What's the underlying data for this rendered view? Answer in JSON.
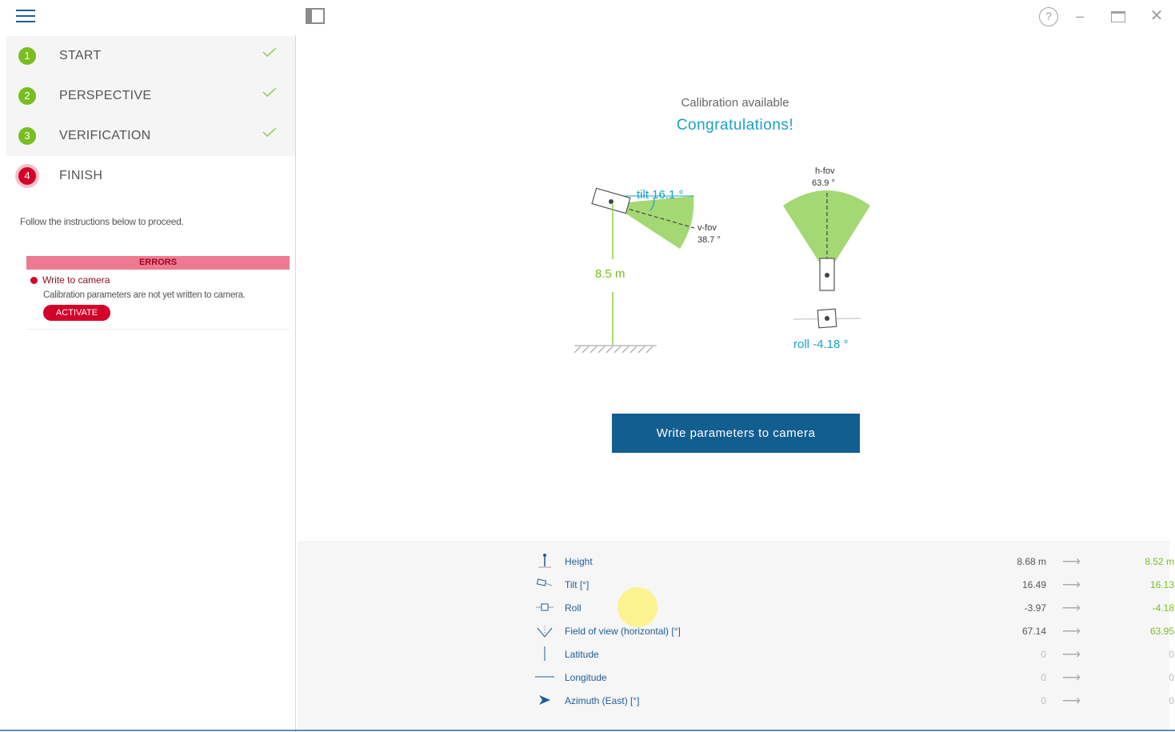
{
  "titlebar": {
    "help_glyph": "?",
    "minimize_glyph": "–",
    "close_glyph": "✕"
  },
  "steps": [
    {
      "number": "1",
      "label": "START",
      "done": true
    },
    {
      "number": "2",
      "label": "PERSPECTIVE",
      "done": true
    },
    {
      "number": "3",
      "label": "VERIFICATION",
      "done": true
    },
    {
      "number": "4",
      "label": "FINISH",
      "done": false
    }
  ],
  "instructions": "Follow the instructions below to proceed.",
  "errors": {
    "header": "ERRORS",
    "items": [
      {
        "title": "Write to camera",
        "description": "Calibration parameters are not yet written to camera.",
        "action_label": "ACTIVATE"
      }
    ]
  },
  "main": {
    "status": "Calibration available",
    "headline": "Congratulations!",
    "write_button_label": "Write parameters to camera"
  },
  "diagram": {
    "tilt_label": "tilt 16.1 °",
    "vfov_label": "v-fov",
    "vfov_value": "38.7 °",
    "height_label": "8.5 m",
    "hfov_label": "h-fov",
    "hfov_value": "63.9 °",
    "roll_label": "roll -4.18 °"
  },
  "params": [
    {
      "name": "Height",
      "old": "8.68 m",
      "new": "8.52 m",
      "icon": "height-icon"
    },
    {
      "name": "Tilt [°]",
      "old": "16.49",
      "new": "16.13",
      "icon": "tilt-icon"
    },
    {
      "name": "Roll",
      "old": "-3.97",
      "new": "-4.18",
      "icon": "roll-icon"
    },
    {
      "name": "Field of view (horizontal) [°]",
      "old": "67.14",
      "new": "63.95",
      "icon": "fov-icon"
    },
    {
      "name": "Latitude",
      "old": "0",
      "new": "0",
      "icon": "latitude-icon"
    },
    {
      "name": "Longitude",
      "old": "0",
      "new": "0",
      "icon": "longitude-icon"
    },
    {
      "name": "Azimuth (East) [°]",
      "old": "0",
      "new": "0",
      "icon": "azimuth-icon"
    }
  ],
  "arrow_glyph": "⟶",
  "colors": {
    "accent_blue": "#1f5d94",
    "success_green": "#78be20",
    "error_red": "#d3002a",
    "headline_cyan": "#1aa0c8",
    "button_blue": "#125e91"
  }
}
